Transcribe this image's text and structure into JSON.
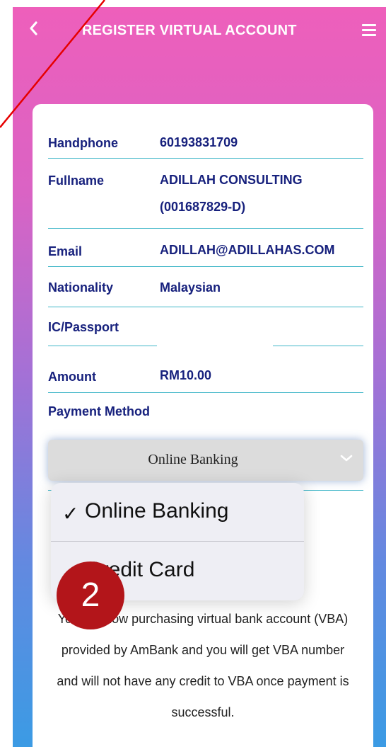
{
  "header": {
    "title": "REGISTER VIRTUAL ACCOUNT",
    "back_icon": "chevron-left-icon",
    "menu_icon": "hamburger-menu-icon"
  },
  "form": {
    "handphone": {
      "label": "Handphone",
      "value": "60193831709"
    },
    "fullname": {
      "label": "Fullname",
      "value_line1": "ADILLAH CONSULTING",
      "value_line2": "(001687829-D)"
    },
    "email": {
      "label": "Email",
      "value": "ADILLAH@ADILLAHAS.COM"
    },
    "nationality": {
      "label": "Nationality",
      "value": "Malaysian"
    },
    "ic_passport": {
      "label": "IC/Passport",
      "value": ""
    },
    "amount": {
      "label": "Amount",
      "value": "RM10.00"
    },
    "payment_method": {
      "label": "Payment Method",
      "selected": "Online Banking"
    }
  },
  "dropdown": {
    "options": [
      {
        "label": "Online Banking",
        "checked": true,
        "check_mark": "✓"
      },
      {
        "label": "Credit Card",
        "checked": false
      }
    ]
  },
  "notice": {
    "line1": "You are now purchasing virtual bank account (VBA)",
    "line2": "provided by AmBank and you will get VBA number",
    "line3": "and will not have any credit to VBA once payment is",
    "line4": "successful."
  },
  "annotation": {
    "step_number": "2"
  },
  "colors": {
    "gradient_top": "#ee5fbb",
    "gradient_bottom": "#3b9be4",
    "label_navy": "#17217d",
    "underline_teal": "#3fb6c8",
    "badge_red": "#b3151a"
  }
}
